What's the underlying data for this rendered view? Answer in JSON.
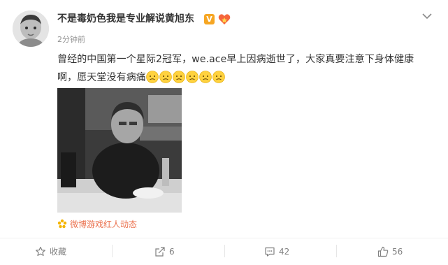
{
  "post": {
    "username": "不是毒奶色我是专业解说黄旭东",
    "verified_badge": "V",
    "timestamp": "2分钟前",
    "text": "曾经的中国第一个星际2冠军，we.ace早上因病逝世了，大家真要注意下身体健康啊，愿天堂没有病痛",
    "emoji_count": 6,
    "source_label": "微博游戏红人动态"
  },
  "actions": {
    "favorite_label": "收藏",
    "repost_count": "6",
    "comment_count": "42",
    "like_count": "56"
  },
  "icons": {
    "menu": "chevron-down-icon",
    "favorite": "star-icon",
    "repost": "share-icon",
    "comment": "comment-icon",
    "like": "thumbs-up-icon",
    "source": "flower-icon"
  },
  "colors": {
    "username": "#333333",
    "timestamp": "#939393",
    "source": "#eb7350",
    "verified": "#f6a623",
    "action_text": "#808080"
  }
}
